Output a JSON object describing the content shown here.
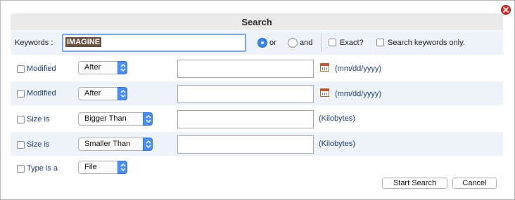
{
  "dialog": {
    "title": "Search",
    "close_icon": "close-icon"
  },
  "keywords": {
    "label": "Keywords :",
    "value": "IMAGINE",
    "or_label": "or",
    "and_label": "and",
    "or_selected": true,
    "exact_label": "Exact?",
    "keywords_only_label": "Search keywords only."
  },
  "criteria": [
    {
      "label": "Modified",
      "select": "After",
      "unit": "(mm/dd/yyyy)",
      "calendar": true
    },
    {
      "label": "Modified",
      "select": "After",
      "unit": "(mm/dd/yyyy)",
      "calendar": true
    },
    {
      "label": "Size is",
      "select": "Bigger Than",
      "unit": "(Kilobytes)",
      "calendar": false
    },
    {
      "label": "Size is",
      "select": "Smaller Than",
      "unit": "(Kilobytes)",
      "calendar": false
    },
    {
      "label": "Type is a",
      "select": "File"
    }
  ],
  "buttons": {
    "start_search": "Start Search",
    "cancel": "Cancel"
  },
  "colors": {
    "accent": "#4d8ef2",
    "title_bg": "#e9e9e9",
    "row_alt_bg": "#eef3f9",
    "label_blue": "#1f3e70",
    "close_red": "#d9322b"
  }
}
